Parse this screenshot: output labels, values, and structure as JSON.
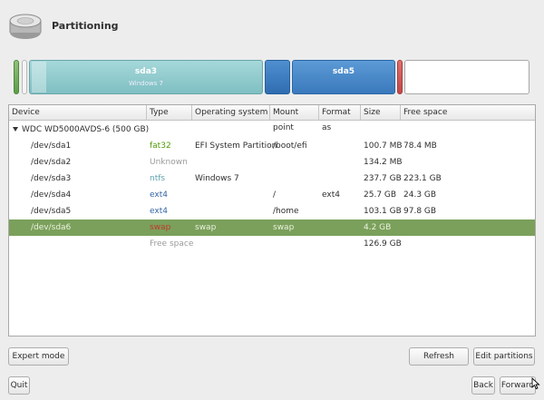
{
  "header": {
    "title": "Partitioning",
    "icon": "hard-disk-icon"
  },
  "partition_bar": {
    "sda3": {
      "label": "sda3",
      "sublabel": "Windows 7"
    },
    "sda5": {
      "label": "sda5"
    },
    "colors": {
      "fat32": "#5e9c48",
      "ntfs": "#7ebfc2",
      "ext4": "#2f6db0",
      "swap": "#c04848"
    }
  },
  "table": {
    "columns": [
      "Device",
      "Type",
      "Operating system",
      "Mount point",
      "Format as",
      "Size",
      "Free space"
    ],
    "disk": "WDC WD5000AVDS-6 (500 GB)",
    "rows": [
      {
        "device": "/dev/sda1",
        "type": "fat32",
        "os": "EFI System Partition",
        "mount": "/boot/efi",
        "format": "",
        "size": "100.7 MB",
        "free": "78.4 MB"
      },
      {
        "device": "/dev/sda2",
        "type": "Unknown",
        "os": "",
        "mount": "",
        "format": "",
        "size": "134.2 MB",
        "free": ""
      },
      {
        "device": "/dev/sda3",
        "type": "ntfs",
        "os": "Windows 7",
        "mount": "",
        "format": "",
        "size": "237.7 GB",
        "free": "223.1 GB"
      },
      {
        "device": "/dev/sda4",
        "type": "ext4",
        "os": "",
        "mount": "/",
        "format": "ext4",
        "size": "25.7 GB",
        "free": "24.3 GB"
      },
      {
        "device": "/dev/sda5",
        "type": "ext4",
        "os": "",
        "mount": "/home",
        "format": "",
        "size": "103.1 GB",
        "free": "97.8 GB"
      },
      {
        "device": "/dev/sda6",
        "type": "swap",
        "os": "swap",
        "mount": "swap",
        "format": "",
        "size": "4.2 GB",
        "free": ""
      },
      {
        "device": "",
        "type": "Free space",
        "os": "",
        "mount": "",
        "format": "",
        "size": "126.9 GB",
        "free": ""
      }
    ],
    "selected_row": "/dev/sda6"
  },
  "buttons": {
    "expert_mode": "Expert mode",
    "refresh": "Refresh",
    "edit_partitions": "Edit partitions",
    "quit": "Quit",
    "back": "Back",
    "forward": "Forward"
  }
}
